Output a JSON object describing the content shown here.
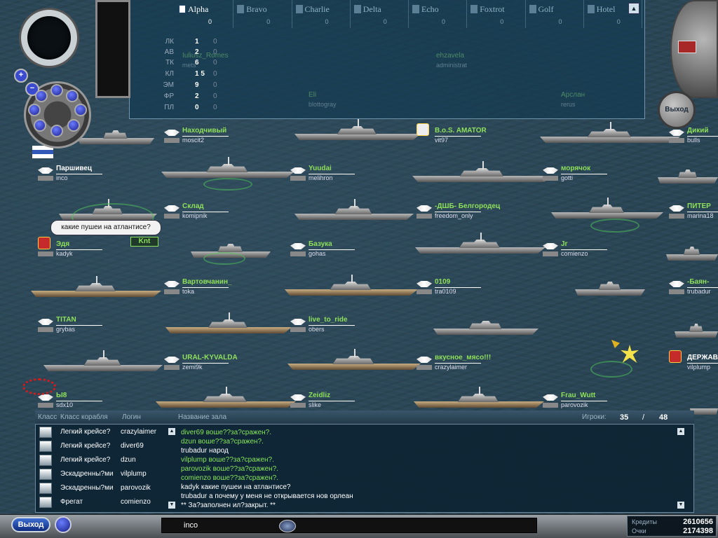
{
  "fleet_panel": {
    "teams": [
      {
        "name": "Alpha",
        "score": "0",
        "active": true
      },
      {
        "name": "Bravo",
        "score": "0",
        "active": false
      },
      {
        "name": "Charlie",
        "score": "0",
        "active": false
      },
      {
        "name": "Delta",
        "score": "0",
        "active": false
      },
      {
        "name": "Echo",
        "score": "0",
        "active": false
      },
      {
        "name": "Foxtrot",
        "score": "0",
        "active": false
      },
      {
        "name": "Golf",
        "score": "0",
        "active": false
      },
      {
        "name": "Hotel",
        "score": "0",
        "active": false
      }
    ],
    "classes": [
      {
        "code": "ЛК",
        "count": "1",
        "zero": "0"
      },
      {
        "code": "АВ",
        "count": "2",
        "zero": "0"
      },
      {
        "code": "ТК",
        "count": "6",
        "zero": "0"
      },
      {
        "code": "КЛ",
        "count": "1 5",
        "zero": "0"
      },
      {
        "code": "ЭМ",
        "count": "9",
        "zero": "0"
      },
      {
        "code": "ФР",
        "count": "2",
        "zero": "0"
      },
      {
        "code": "ПЛ",
        "count": "0",
        "zero": "0"
      }
    ],
    "ghost_labels": [
      {
        "name": "Iuliusz_Romes",
        "user": "mets"
      },
      {
        "name": "ehzavela",
        "user": "administrat"
      },
      {
        "name": "Eli",
        "user": "blottogray"
      },
      {
        "name": "Арслан",
        "user": "rerus"
      }
    ],
    "scroll_up": "▲"
  },
  "ships": [
    {
      "name": "Находчивый",
      "user": "moscit2"
    },
    {
      "name": "B.o.S. AMATOR",
      "user": "vit97"
    },
    {
      "name": "Дикий",
      "user": "bulls"
    },
    {
      "name": "Паршивец",
      "user": "inco"
    },
    {
      "name": "Yuudai",
      "user": "melihron"
    },
    {
      "name": "морячок",
      "user": "gotti"
    },
    {
      "name": "Склад",
      "user": "komipnik"
    },
    {
      "name": "-ДШБ- Белгородец",
      "user": "freedom_only"
    },
    {
      "name": "ПИТЕР",
      "user": "marina18"
    },
    {
      "name": "Эдя",
      "user": "kadyk"
    },
    {
      "name": "Базука",
      "user": "gohas"
    },
    {
      "name": "Jr",
      "user": "comienzo"
    },
    {
      "name": "Вартовчанин_",
      "user": "toka"
    },
    {
      "name": "0109",
      "user": "tra0109"
    },
    {
      "name": "-Баян-",
      "user": "trubadur"
    },
    {
      "name": "TITAN",
      "user": "grybas"
    },
    {
      "name": "live_to_ride",
      "user": "obers"
    },
    {
      "name": "URAL-KYVALDA",
      "user": "zemi9k"
    },
    {
      "name": "вкусное_мясо!!!",
      "user": "crazylaimer"
    },
    {
      "name": "ДЕРЖАВА",
      "user": "vilplump"
    },
    {
      "name": "Ы8",
      "user": "sdx10"
    },
    {
      "name": "Zeidliz",
      "user": "slike"
    },
    {
      "name": "Frau_Wutt",
      "user": "parovozik"
    }
  ],
  "speech_bubble": "какие пушеи на атлантисе?",
  "knt_tag": "Knt",
  "top_right_button": "Выход",
  "lobby": {
    "headers": {
      "class": "Класс",
      "ship_class": "Класс корабля",
      "login": "Логин",
      "room": "Название зала",
      "players": "Игроки:"
    },
    "players_count": "35",
    "players_slash": "/",
    "players_max": "48",
    "players": [
      {
        "class": "Легкий крейсе?",
        "login": "crazylaimer"
      },
      {
        "class": "Легкий крейсе?",
        "login": "diver69"
      },
      {
        "class": "Легкий крейсе?",
        "login": "dzun"
      },
      {
        "class": "Эскадренны?ми",
        "login": "vilplump"
      },
      {
        "class": "Эскадренны?ми",
        "login": "parovozik"
      },
      {
        "class": "Фрегат",
        "login": "comienzo"
      }
    ],
    "chat": [
      {
        "text": "diver69 воше??за?сражен?.",
        "color": "green"
      },
      {
        "text": "dzun воше??за?сражен?.",
        "color": "green"
      },
      {
        "text": "trubadur   народ",
        "color": "white"
      },
      {
        "text": "vilplump воше??за?сражен?.",
        "color": "green"
      },
      {
        "text": "parovozik воше??за?сражен?.",
        "color": "green"
      },
      {
        "text": "comienzo воше??за?сражен?.",
        "color": "green"
      },
      {
        "text": "kadyk   какие пушеи на атлантисе?",
        "color": "white"
      },
      {
        "text": "trubadur   а почему у меня не открывается нов орлеан",
        "color": "white"
      },
      {
        "text": "** За?заполнен ил?закрыт. **",
        "color": "white"
      }
    ],
    "scroll_up": "▲",
    "scroll_down": "▼"
  },
  "bottom": {
    "exit_label": "Выход",
    "input_value": "inco",
    "credits_label": "Кредиты",
    "credits_value": "2610656",
    "points_label": "Очки",
    "points_value": "2174398"
  },
  "colors": {
    "sea": "#2a4656",
    "name_green": "#8ee05a",
    "chat_green": "#87e45a",
    "panel": "#143a50"
  }
}
